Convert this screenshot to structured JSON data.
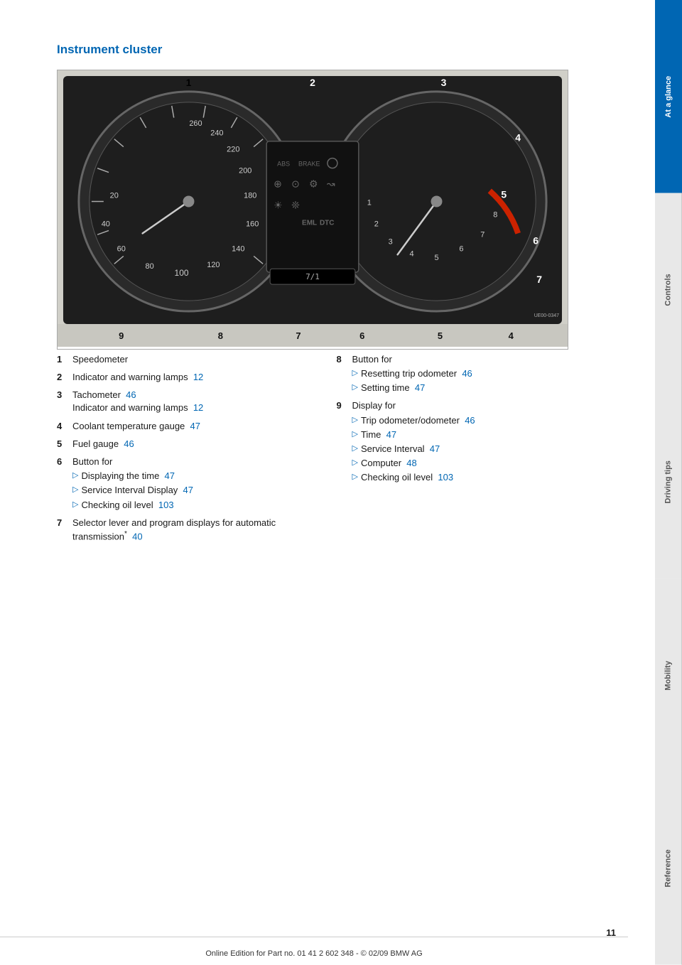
{
  "page": {
    "title": "Instrument cluster",
    "number": "11",
    "footer_text": "Online Edition for Part no. 01 41 2 602 348 - © 02/09 BMW AG"
  },
  "sidebar": {
    "tabs": [
      {
        "id": "at-a-glance",
        "label": "At a glance",
        "active": true
      },
      {
        "id": "controls",
        "label": "Controls",
        "active": false
      },
      {
        "id": "driving-tips",
        "label": "Driving tips",
        "active": false
      },
      {
        "id": "mobility",
        "label": "Mobility",
        "active": false
      },
      {
        "id": "reference",
        "label": "Reference",
        "active": false
      }
    ]
  },
  "callout_numbers": {
    "bottom_bar": [
      "9",
      "8",
      "7",
      "6",
      "5",
      "4"
    ],
    "top_bar": [
      "1",
      "2",
      "3"
    ]
  },
  "descriptions": {
    "left_col": [
      {
        "number": "1",
        "label": "Speedometer",
        "sub_items": []
      },
      {
        "number": "2",
        "label": "Indicator and warning lamps",
        "page_ref": "12",
        "sub_items": []
      },
      {
        "number": "3",
        "label": "Tachometer",
        "page_ref": "46",
        "sub_label": "Indicator and warning lamps",
        "sub_page_ref": "12",
        "sub_items": []
      },
      {
        "number": "4",
        "label": "Coolant temperature gauge",
        "page_ref": "47",
        "sub_items": []
      },
      {
        "number": "5",
        "label": "Fuel gauge",
        "page_ref": "46",
        "sub_items": []
      },
      {
        "number": "6",
        "label": "Button for",
        "sub_items": [
          {
            "text": "Displaying the time",
            "page_ref": "47"
          },
          {
            "text": "Service Interval Display",
            "page_ref": "47"
          },
          {
            "text": "Checking oil level",
            "page_ref": "103"
          }
        ]
      },
      {
        "number": "7",
        "label": "Selector lever and program displays for automatic transmission",
        "asterisk": true,
        "page_ref": "40",
        "sub_items": []
      }
    ],
    "right_col": [
      {
        "number": "8",
        "label": "Button for",
        "sub_items": [
          {
            "text": "Resetting trip odometer",
            "page_ref": "46"
          },
          {
            "text": "Setting time",
            "page_ref": "47"
          }
        ]
      },
      {
        "number": "9",
        "label": "Display for",
        "sub_items": [
          {
            "text": "Trip odometer/odometer",
            "page_ref": "46"
          },
          {
            "text": "Time",
            "page_ref": "47"
          },
          {
            "text": "Service Interval",
            "page_ref": "47"
          },
          {
            "text": "Computer",
            "page_ref": "48"
          },
          {
            "text": "Checking oil level",
            "page_ref": "103"
          }
        ]
      }
    ]
  }
}
